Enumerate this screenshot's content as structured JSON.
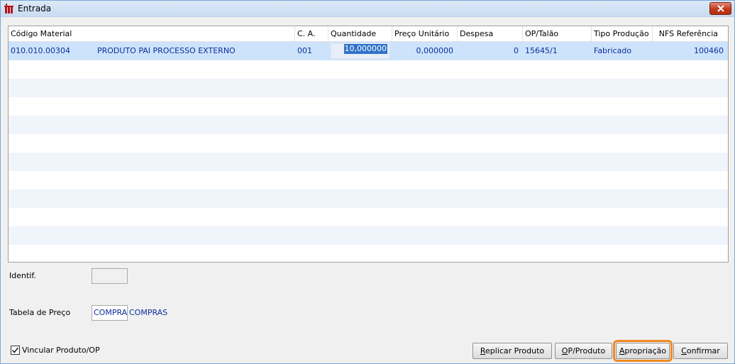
{
  "window": {
    "title": "Entrada",
    "app_icon": "factory-icon",
    "close_icon": "close-icon"
  },
  "grid": {
    "columns": [
      "Código Material",
      "C. A.",
      "Quantidade",
      "Preço Unitário",
      "Despesa",
      "OP/Talão",
      "Tipo Produção",
      "NFS Referência"
    ],
    "rows": [
      {
        "codigo": "010.010.00304",
        "descricao": "PRODUTO PAI PROCESSO EXTERNO",
        "ca": "001",
        "quantidade": "10,000000",
        "preco": "0,000000",
        "despesa": "0",
        "op": "15645/1",
        "tipo": "Fabricado",
        "nfs": "100460"
      }
    ]
  },
  "form": {
    "identif_label": "Identif.",
    "identif_value": "",
    "tabela_label": "Tabela de Preço",
    "tabela_value": "COMPRA",
    "tabela_desc": "COMPRAS",
    "vincular_label": "Vincular Produto/OP",
    "vincular_checked": true
  },
  "buttons": {
    "replicar_first": "R",
    "replicar_rest": "eplicar Produto",
    "op_first": "O",
    "op_rest": "P/Produto",
    "apropriacao_first": "A",
    "apropriacao_rest": "propriação",
    "confirmar_first": "C",
    "confirmar_rest": "onfirmar"
  },
  "colors": {
    "accent": "#f08a24",
    "selection": "#cde3fb",
    "text_blue": "#0c2f9a"
  }
}
